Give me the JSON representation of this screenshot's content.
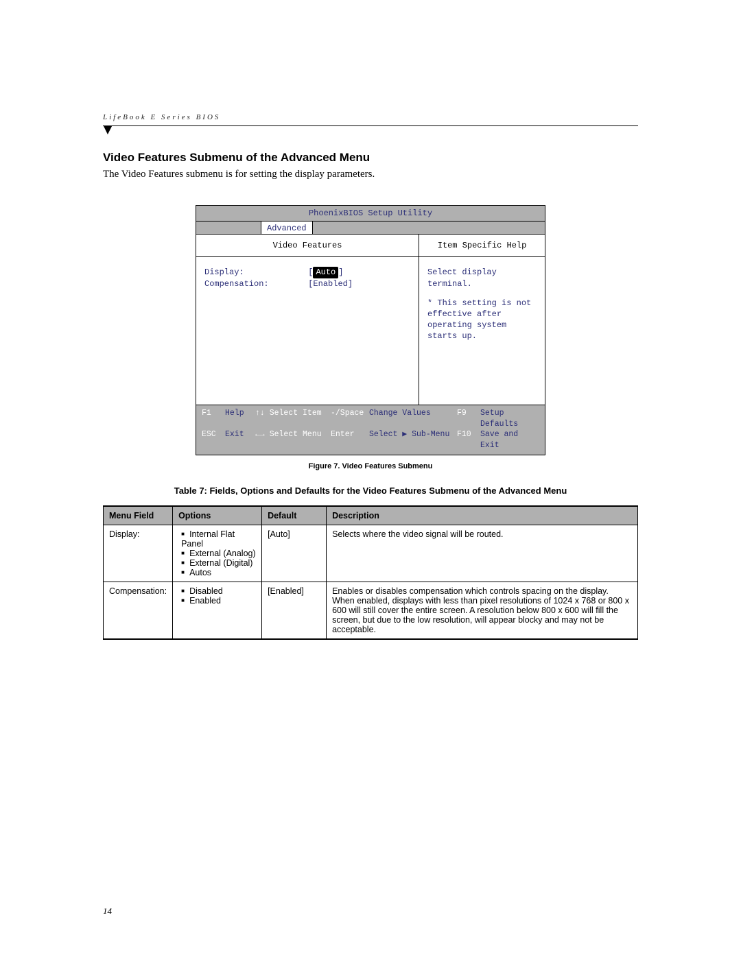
{
  "running_head": "LifeBook E Series BIOS",
  "section_title": "Video Features Submenu of the Advanced Menu",
  "body_text": "The Video Features submenu is for setting the display parameters.",
  "bios": {
    "title": "PhoenixBIOS Setup Utility",
    "active_menu": "Advanced",
    "submenu_title": "Video Features",
    "help_title": "Item Specific Help",
    "settings": {
      "display_label": "Display:",
      "display_value": "Auto",
      "compensation_label": "Compensation:",
      "compensation_value": "[Enabled]"
    },
    "help_text": {
      "line1": "Select display terminal.",
      "line2": "* This setting is not",
      "line3": "effective after",
      "line4": "operating system",
      "line5": "starts up."
    },
    "footer": {
      "r1": {
        "k1": "F1",
        "l1": "Help",
        "arrow": "↑↓ Select Item",
        "m1": "-/Space",
        "m2": "Change Values",
        "fk": "F9",
        "fl": "Setup Defaults"
      },
      "r2": {
        "k1": "ESC",
        "l1": "Exit",
        "arrow": "←→ Select Menu",
        "m1": "Enter",
        "m2": "Select ▶ Sub-Menu",
        "fk": "F10",
        "fl": "Save and Exit"
      }
    }
  },
  "figure_caption": "Figure 7.  Video Features Submenu",
  "table_caption": "Table 7: Fields, Options and Defaults for the Video Features Submenu of the Advanced Menu",
  "table": {
    "headers": {
      "menu_field": "Menu Field",
      "options": "Options",
      "def": "Default",
      "desc": "Description"
    },
    "rows": [
      {
        "menu_field": "Display:",
        "options": [
          "Internal Flat Panel",
          "External (Analog)",
          "External (Digital)",
          "Autos"
        ],
        "def": "[Auto]",
        "desc": "Selects where the video signal will be routed."
      },
      {
        "menu_field": "Compensation:",
        "options": [
          "Disabled",
          "Enabled"
        ],
        "def": "[Enabled]",
        "desc": "Enables or disables compensation which controls spacing on the display. When enabled, displays with less than pixel resolutions of 1024 x 768 or 800 x 600 will still cover the entire screen. A resolution below 800 x 600 will fill the screen, but due to the low resolution, will appear blocky and may not be acceptable."
      }
    ]
  },
  "page_number": "14"
}
